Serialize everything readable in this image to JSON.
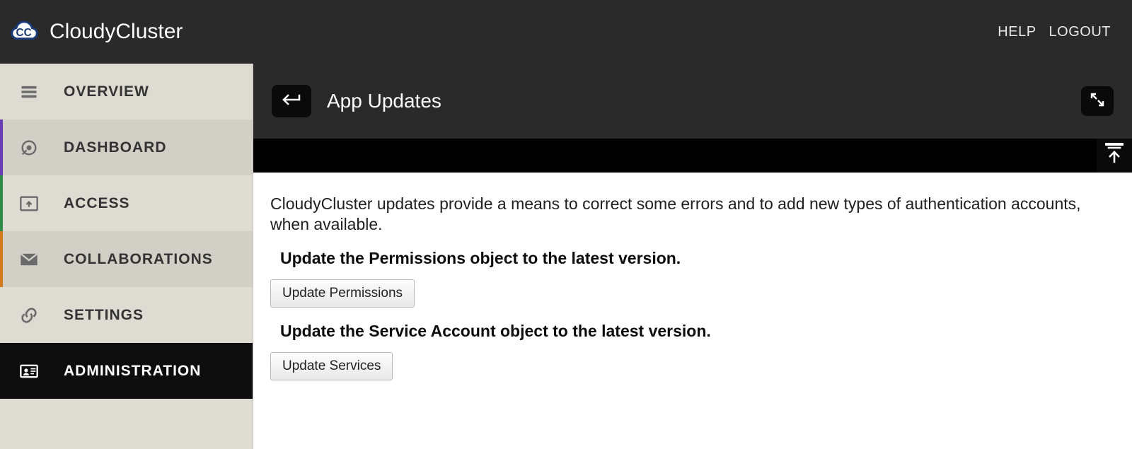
{
  "brand": {
    "name": "CloudyCluster"
  },
  "topbar": {
    "help": "HELP",
    "logout": "LOGOUT"
  },
  "sidebar": {
    "items": [
      {
        "label": "OVERVIEW"
      },
      {
        "label": "DASHBOARD"
      },
      {
        "label": "ACCESS"
      },
      {
        "label": "COLLABORATIONS"
      },
      {
        "label": "SETTINGS"
      },
      {
        "label": "ADMINISTRATION"
      }
    ]
  },
  "page": {
    "title": "App Updates",
    "intro": "CloudyCluster updates provide a means to correct some errors and to add new types of authentication accounts, when available.",
    "sections": [
      {
        "heading": "Update the Permissions object to the latest version.",
        "button": "Update Permissions"
      },
      {
        "heading": "Update the Service Account object to the latest version.",
        "button": "Update Services"
      }
    ]
  }
}
